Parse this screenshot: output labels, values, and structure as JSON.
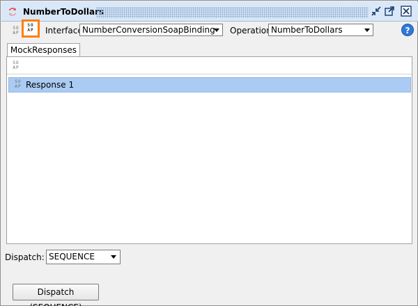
{
  "window": {
    "title": "NumberToDollars"
  },
  "toolbar": {
    "interface_label": "Interface",
    "interface_value": "NumberConversionSoapBinding",
    "operation_label": "Operation",
    "operation_value": "NumberToDollars",
    "help_glyph": "?"
  },
  "icons": {
    "soap_glyph": "SO\nAP"
  },
  "tabs": [
    {
      "label": "MockResponses",
      "selected": true
    }
  ],
  "responses": [
    {
      "label": "Response 1",
      "selected": true
    }
  ],
  "dispatch": {
    "label": "Dispatch:",
    "value": "SEQUENCE",
    "button_label": "Dispatch (SEQUENCE)"
  },
  "colors": {
    "titlebar": "#d9e8f8",
    "selection": "#aacbf3",
    "active_outline": "#ff7f00",
    "help": "#2f78d6",
    "title_icon": "#e05050"
  }
}
